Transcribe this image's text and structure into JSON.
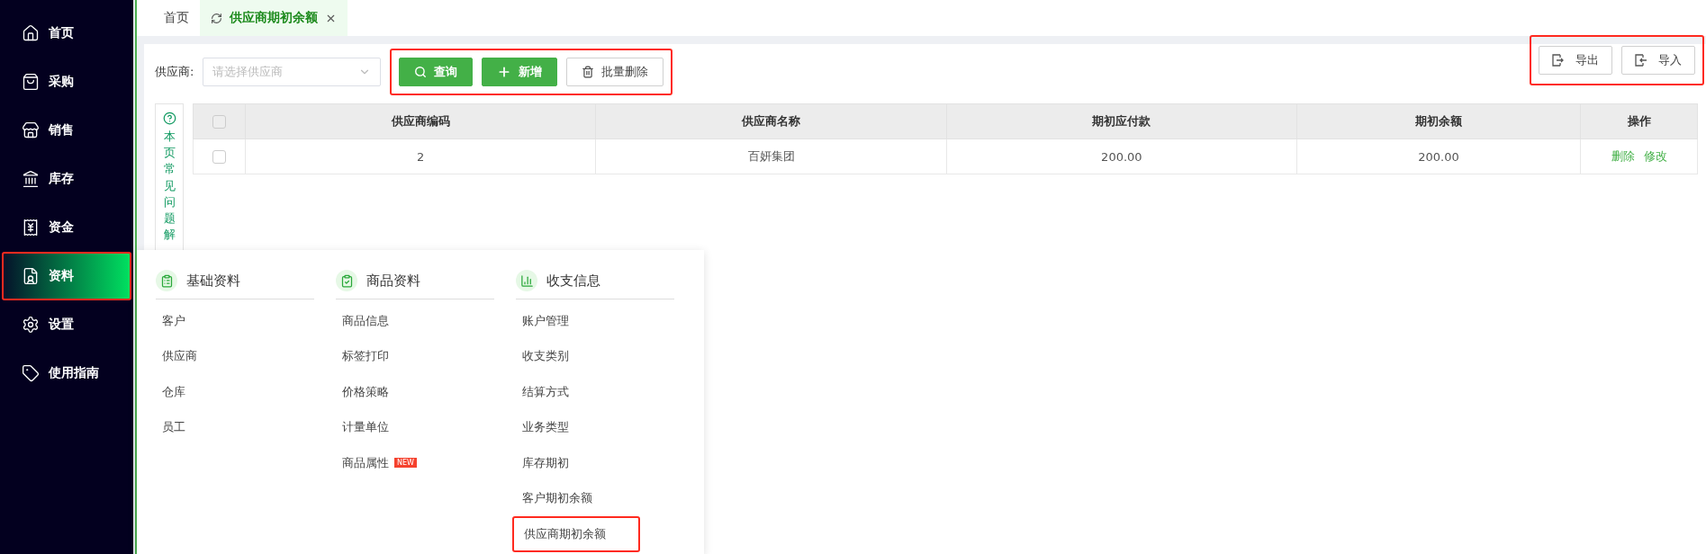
{
  "sidebar": {
    "items": [
      {
        "label": "首页",
        "selected": false,
        "highlighted": false
      },
      {
        "label": "采购",
        "selected": false,
        "highlighted": false
      },
      {
        "label": "销售",
        "selected": false,
        "highlighted": false
      },
      {
        "label": "库存",
        "selected": false,
        "highlighted": false
      },
      {
        "label": "资金",
        "selected": false,
        "highlighted": false
      },
      {
        "label": "资料",
        "selected": true,
        "highlighted": true
      },
      {
        "label": "设置",
        "selected": false,
        "highlighted": false
      },
      {
        "label": "使用指南",
        "selected": false,
        "highlighted": false
      }
    ]
  },
  "tabs": [
    {
      "label": "首页",
      "selected": false,
      "closable": false
    },
    {
      "label": "供应商期初余额",
      "selected": true,
      "closable": true
    }
  ],
  "filter": {
    "label": "供应商:",
    "placeholder": "请选择供应商"
  },
  "actions": {
    "highlighted": true,
    "buttons": [
      {
        "label": "查询",
        "kind": "primary"
      },
      {
        "label": "新增",
        "kind": "primary"
      },
      {
        "label": "批量删除",
        "kind": "default"
      }
    ]
  },
  "io_buttons": {
    "highlighted": true,
    "buttons": [
      {
        "label": "导出",
        "kind": "export"
      },
      {
        "label": "导入",
        "kind": "import"
      }
    ]
  },
  "help": {
    "text": "本页常见问题解"
  },
  "table": {
    "select_all_checked": false,
    "columns": [
      "供应商编码",
      "供应商名称",
      "期初应付款",
      "期初余额",
      "操作"
    ],
    "rows": [
      {
        "checked": false,
        "cells": [
          "2",
          "百妍集团",
          "200.00",
          "200.00"
        ],
        "actions": [
          "删除",
          "修改"
        ]
      }
    ]
  },
  "menu": {
    "groups": [
      {
        "title": "基础资料",
        "items": [
          {
            "label": "客户",
            "highlighted": false
          },
          {
            "label": "供应商",
            "highlighted": false
          },
          {
            "label": "仓库",
            "highlighted": false
          },
          {
            "label": "员工",
            "highlighted": false
          }
        ]
      },
      {
        "title": "商品资料",
        "items": [
          {
            "label": "商品信息",
            "highlighted": false
          },
          {
            "label": "标签打印",
            "highlighted": false
          },
          {
            "label": "价格策略",
            "highlighted": false
          },
          {
            "label": "计量单位",
            "highlighted": false
          },
          {
            "label": "商品属性",
            "highlighted": false,
            "badge": "NEW"
          }
        ]
      },
      {
        "title": "收支信息",
        "items": [
          {
            "label": "账户管理",
            "highlighted": false
          },
          {
            "label": "收支类别",
            "highlighted": false
          },
          {
            "label": "结算方式",
            "highlighted": false
          },
          {
            "label": "业务类型",
            "highlighted": false
          },
          {
            "label": "库存期初",
            "highlighted": false
          },
          {
            "label": "客户期初余额",
            "highlighted": false
          },
          {
            "label": "供应商期初余额",
            "highlighted": true
          }
        ]
      }
    ]
  }
}
